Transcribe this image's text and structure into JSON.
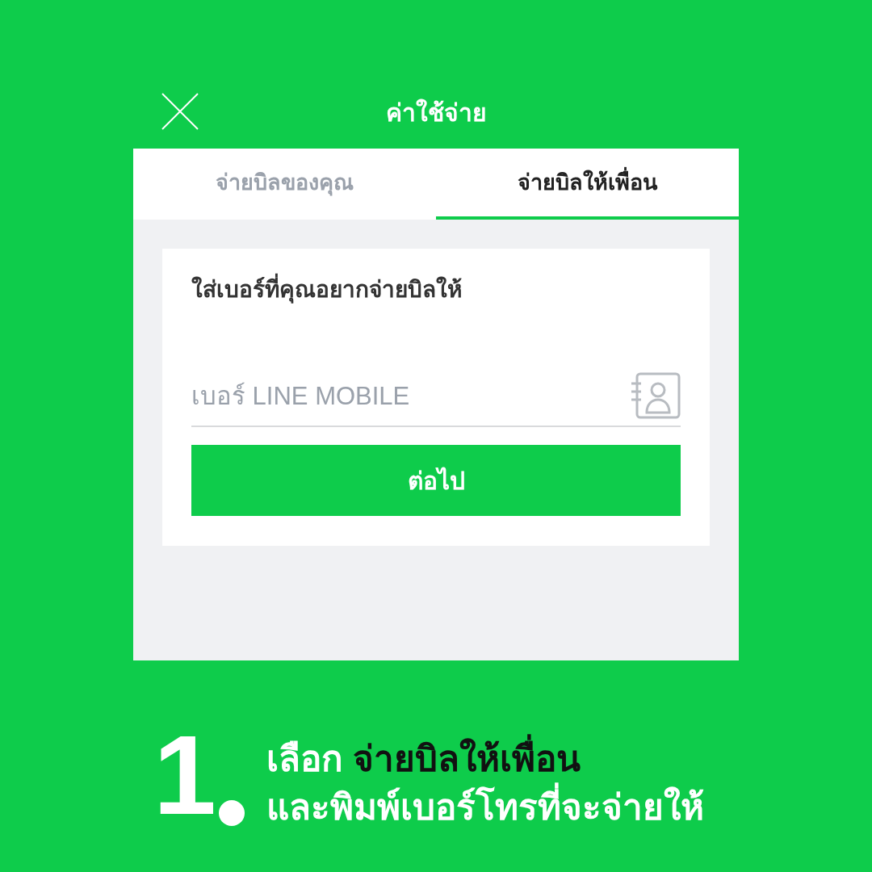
{
  "header": {
    "title": "ค่าใช้จ่าย"
  },
  "tabs": [
    {
      "label": "จ่ายบิลของคุณ",
      "selected": false
    },
    {
      "label": "จ่ายบิลให้เพื่อน",
      "selected": true
    }
  ],
  "form": {
    "label": "ใส่เบอร์ที่คุณอยากจ่ายบิลให้",
    "phone_field": {
      "placeholder": "เบอร์ LINE MOBILE"
    },
    "button": "ต่อไป"
  },
  "caption": {
    "step_number": "1",
    "line_1_lead": "เลือก",
    "line_1_highlight": "จ่ายบิลให้เพื่อน",
    "line_2": "และพิมพ์เบอร์โทรที่จะจ่ายให้"
  }
}
